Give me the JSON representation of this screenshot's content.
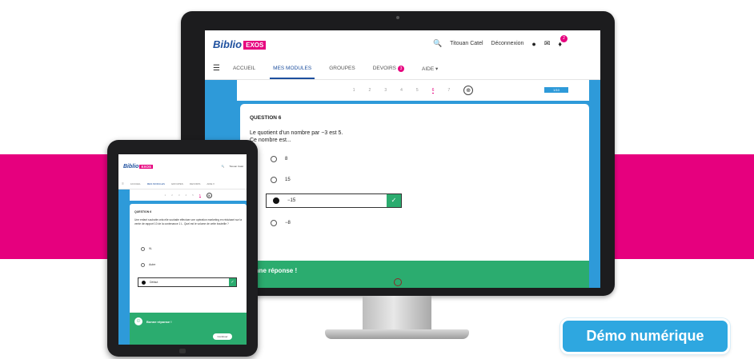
{
  "colors": {
    "pink": "#e6007e",
    "blue": "#2e9ad9",
    "green": "#2bac6f",
    "navy": "#1d4f9e",
    "badge": "#2ea7e0"
  },
  "desktop": {
    "logo": {
      "text": "Biblio",
      "tag": "EXOS"
    },
    "header": {
      "user": "Titouan Catel",
      "logout": "Déconnexion",
      "notif_count": "2"
    },
    "nav": {
      "home": "ACCUEIL",
      "modules": "MES MODULES",
      "groups": "GROUPES",
      "homework": "DEVOIRS",
      "homework_count": "3",
      "help": "AIDE ▾"
    },
    "progress": {
      "steps": [
        "1",
        "2",
        "3",
        "4",
        "5",
        "6",
        "7"
      ],
      "current": "6",
      "ribbon": "1/10"
    },
    "question": {
      "title": "QUESTION 6",
      "text_line1": "Le quotient d'un nombre par −3 est 5.",
      "text_line2": "Ce nombre est...",
      "options": [
        "8",
        "15",
        "−15",
        "−8"
      ]
    },
    "result": "Bonne réponse !"
  },
  "tablet": {
    "logo": {
      "text": "Biblio",
      "tag": "EXOS"
    },
    "header": {
      "user": "Titouan Catel"
    },
    "nav": {
      "home": "ACCUEIL",
      "modules": "MES MODULES",
      "groups": "GROUPES",
      "homework": "DEVOIRS",
      "help": "AIDE ▾"
    },
    "question": {
      "title": "QUESTION 6",
      "text": "Une enfant souhaite cela elle souhaite effectuer une opération marketing en réduisant sur la vente de rapport 10 de la contenance 1 L. Quel est le volume de cette bouteille ?",
      "options": [
        "9L",
        "Autre",
        "Défaut"
      ]
    },
    "result": "Bonne réponse !",
    "continue": "Continuer"
  },
  "demo_badge": "Démo numérique"
}
